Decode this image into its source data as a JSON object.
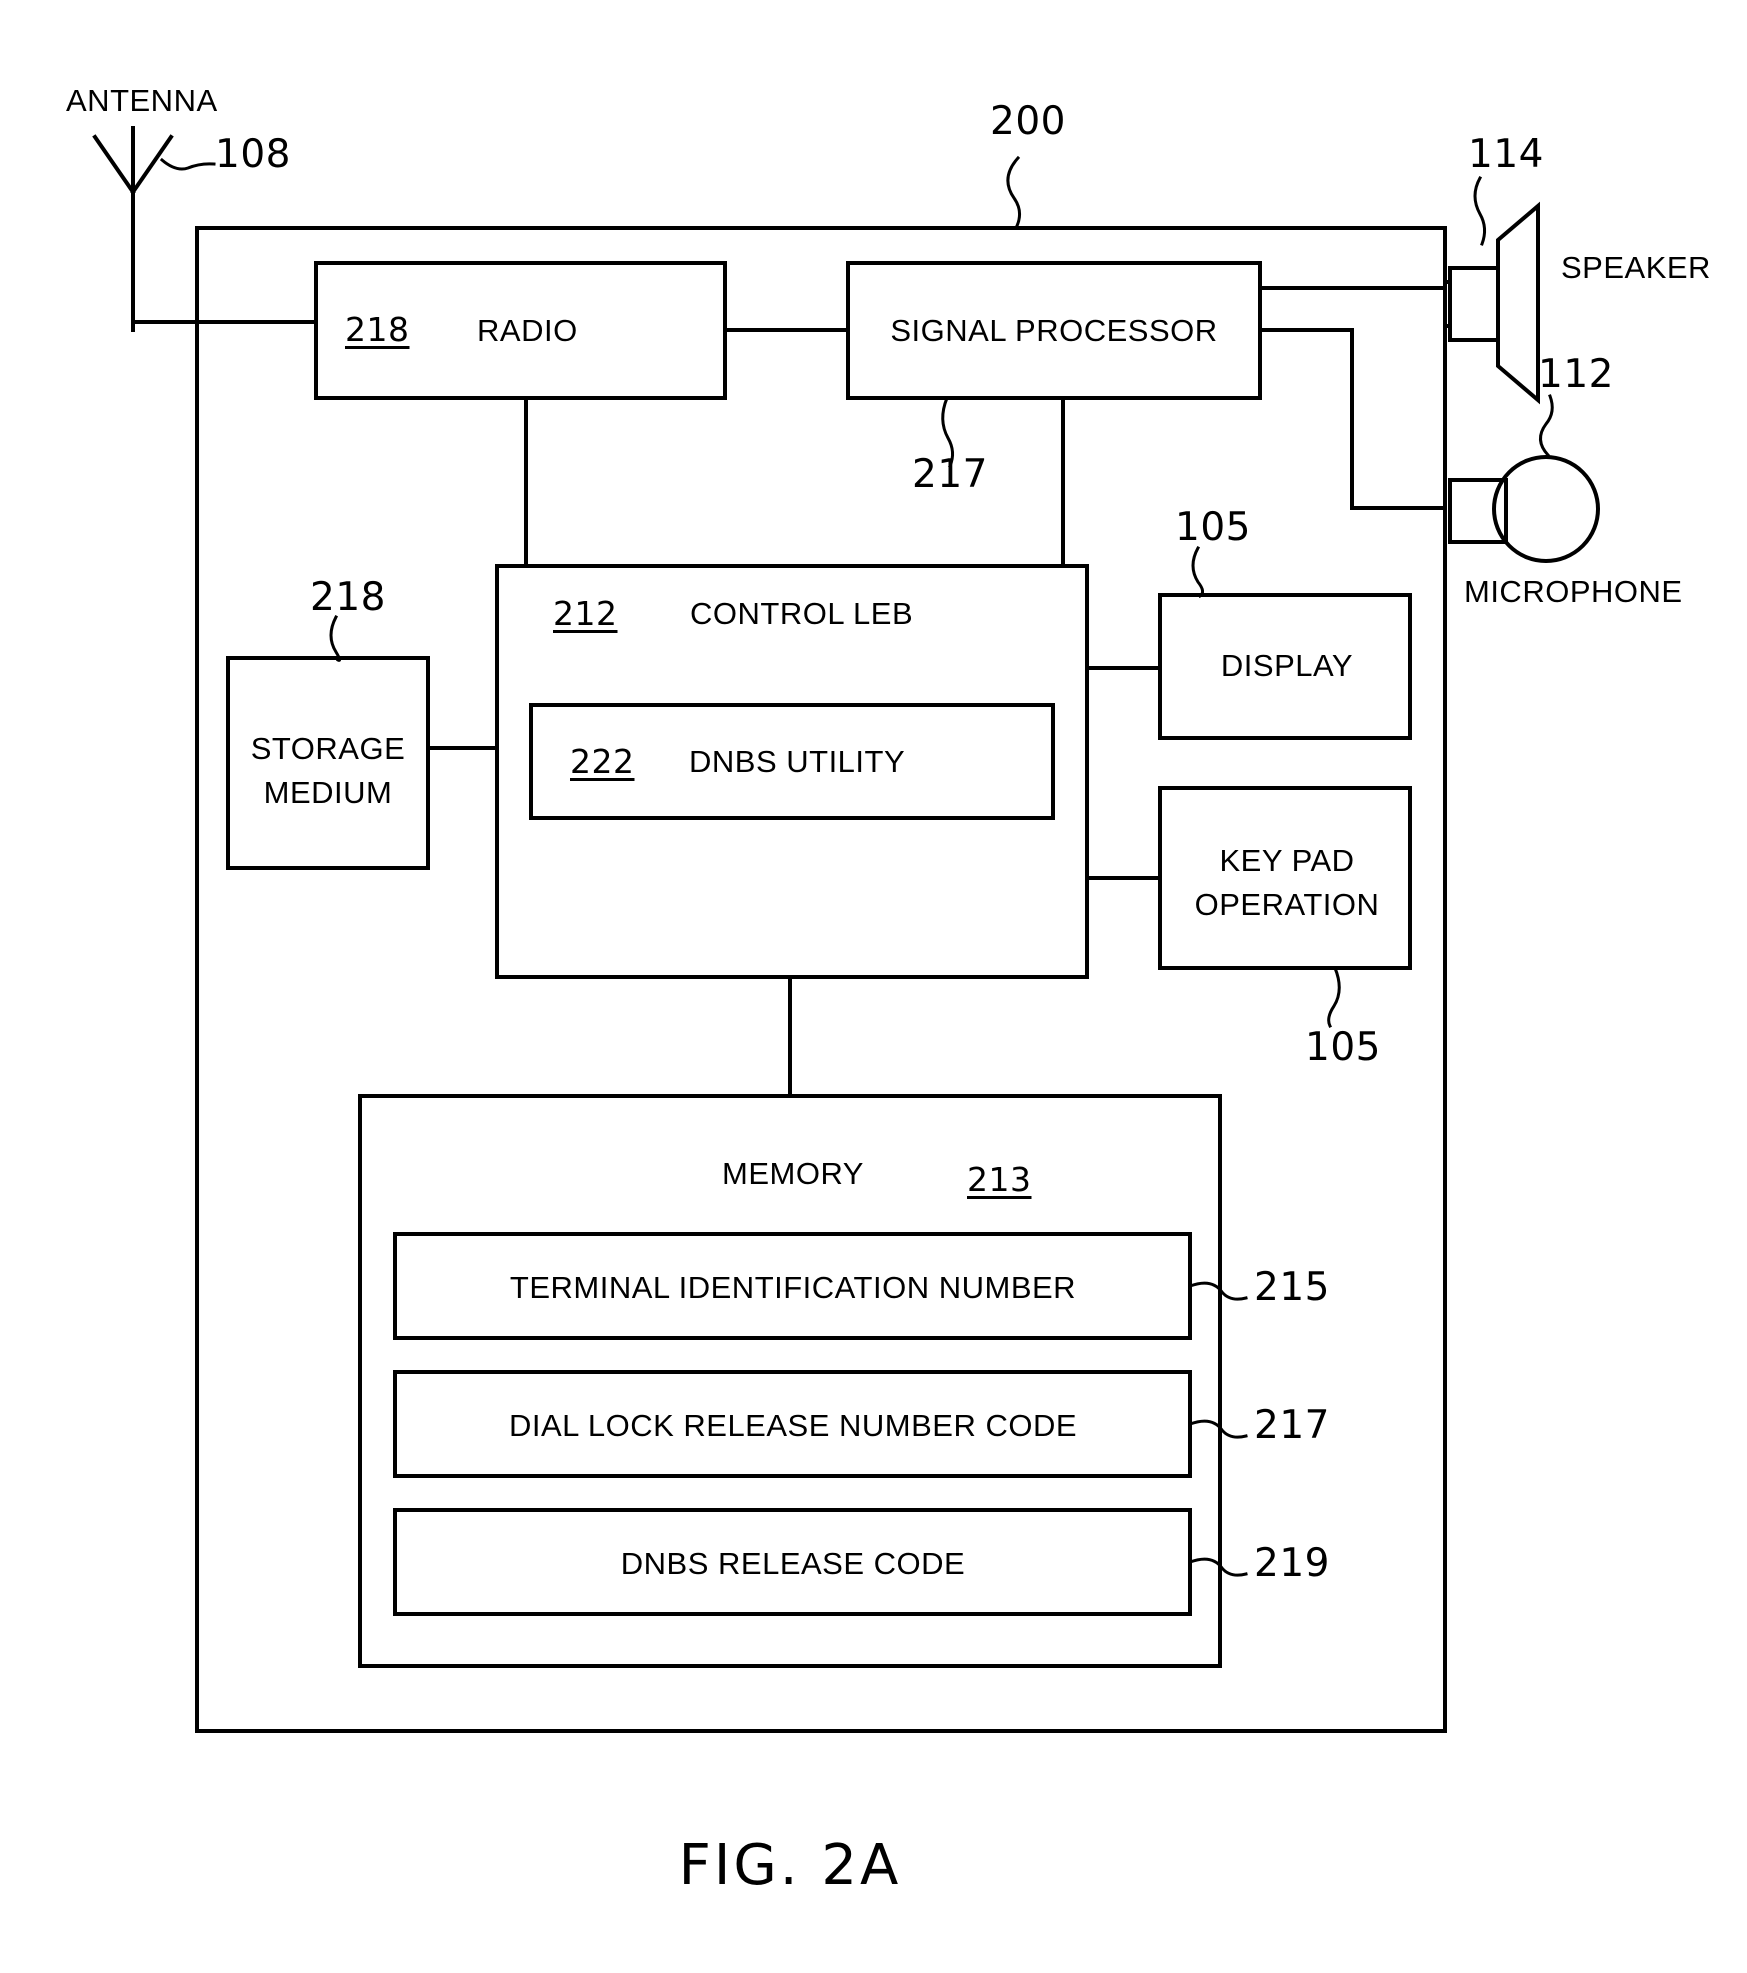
{
  "figure": {
    "caption": "FIG. 2A",
    "system_ref": "200"
  },
  "external_components": [
    {
      "name": "antenna",
      "label": "ANTENNA",
      "ref": "108"
    },
    {
      "name": "speaker",
      "label": "SPEAKER",
      "ref": "114"
    },
    {
      "name": "microphone",
      "label": "MICROPHONE",
      "ref": "112"
    }
  ],
  "blocks": [
    {
      "name": "radio",
      "label": "RADIO",
      "ref": "218",
      "ref_style": "inline-underlined"
    },
    {
      "name": "signal-processor",
      "label": "SIGNAL PROCESSOR",
      "ref": "217",
      "ref_style": "leader"
    },
    {
      "name": "storage-medium",
      "label_line1": "STORAGE",
      "label_line2": "MEDIUM",
      "ref": "218",
      "ref_style": "leader"
    },
    {
      "name": "control-leb",
      "label": "CONTROL LEB",
      "ref": "212",
      "ref_style": "inline-underlined"
    },
    {
      "name": "dnbs-utility",
      "label": "DNBS UTILITY",
      "ref": "222",
      "ref_style": "inline-underlined"
    },
    {
      "name": "display",
      "label": "DISPLAY",
      "ref": "105",
      "ref_style": "leader"
    },
    {
      "name": "key-pad-operation",
      "label_line1": "KEY PAD",
      "label_line2": "OPERATION",
      "ref": "105",
      "ref_style": "leader"
    },
    {
      "name": "memory",
      "label": "MEMORY",
      "ref": "213",
      "ref_style": "inline-underlined"
    }
  ],
  "memory_entries": [
    {
      "label": "TERMINAL IDENTIFICATION NUMBER",
      "ref": "215"
    },
    {
      "label": "DIAL LOCK RELEASE NUMBER CODE",
      "ref": "217"
    },
    {
      "label": "DNBS RELEASE CODE",
      "ref": "219"
    }
  ],
  "colors": {
    "ink": "#000000",
    "paper": "#ffffff"
  }
}
